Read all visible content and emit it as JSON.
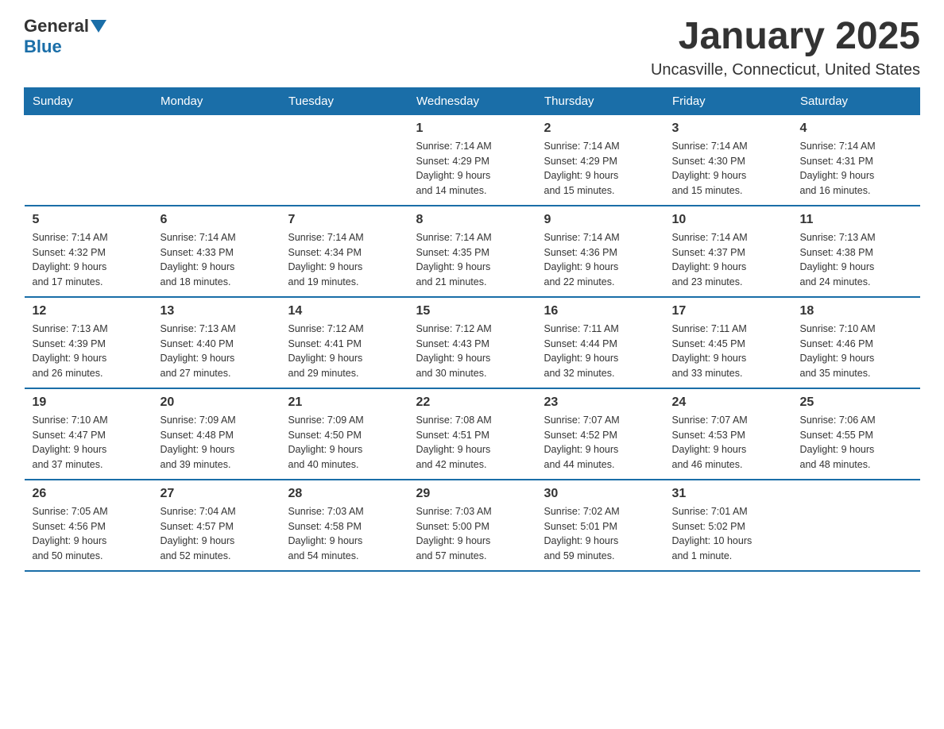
{
  "header": {
    "logo_general": "General",
    "logo_blue": "Blue",
    "month_title": "January 2025",
    "location": "Uncasville, Connecticut, United States"
  },
  "weekdays": [
    "Sunday",
    "Monday",
    "Tuesday",
    "Wednesday",
    "Thursday",
    "Friday",
    "Saturday"
  ],
  "weeks": [
    [
      {
        "day": "",
        "info": ""
      },
      {
        "day": "",
        "info": ""
      },
      {
        "day": "",
        "info": ""
      },
      {
        "day": "1",
        "info": "Sunrise: 7:14 AM\nSunset: 4:29 PM\nDaylight: 9 hours\nand 14 minutes."
      },
      {
        "day": "2",
        "info": "Sunrise: 7:14 AM\nSunset: 4:29 PM\nDaylight: 9 hours\nand 15 minutes."
      },
      {
        "day": "3",
        "info": "Sunrise: 7:14 AM\nSunset: 4:30 PM\nDaylight: 9 hours\nand 15 minutes."
      },
      {
        "day": "4",
        "info": "Sunrise: 7:14 AM\nSunset: 4:31 PM\nDaylight: 9 hours\nand 16 minutes."
      }
    ],
    [
      {
        "day": "5",
        "info": "Sunrise: 7:14 AM\nSunset: 4:32 PM\nDaylight: 9 hours\nand 17 minutes."
      },
      {
        "day": "6",
        "info": "Sunrise: 7:14 AM\nSunset: 4:33 PM\nDaylight: 9 hours\nand 18 minutes."
      },
      {
        "day": "7",
        "info": "Sunrise: 7:14 AM\nSunset: 4:34 PM\nDaylight: 9 hours\nand 19 minutes."
      },
      {
        "day": "8",
        "info": "Sunrise: 7:14 AM\nSunset: 4:35 PM\nDaylight: 9 hours\nand 21 minutes."
      },
      {
        "day": "9",
        "info": "Sunrise: 7:14 AM\nSunset: 4:36 PM\nDaylight: 9 hours\nand 22 minutes."
      },
      {
        "day": "10",
        "info": "Sunrise: 7:14 AM\nSunset: 4:37 PM\nDaylight: 9 hours\nand 23 minutes."
      },
      {
        "day": "11",
        "info": "Sunrise: 7:13 AM\nSunset: 4:38 PM\nDaylight: 9 hours\nand 24 minutes."
      }
    ],
    [
      {
        "day": "12",
        "info": "Sunrise: 7:13 AM\nSunset: 4:39 PM\nDaylight: 9 hours\nand 26 minutes."
      },
      {
        "day": "13",
        "info": "Sunrise: 7:13 AM\nSunset: 4:40 PM\nDaylight: 9 hours\nand 27 minutes."
      },
      {
        "day": "14",
        "info": "Sunrise: 7:12 AM\nSunset: 4:41 PM\nDaylight: 9 hours\nand 29 minutes."
      },
      {
        "day": "15",
        "info": "Sunrise: 7:12 AM\nSunset: 4:43 PM\nDaylight: 9 hours\nand 30 minutes."
      },
      {
        "day": "16",
        "info": "Sunrise: 7:11 AM\nSunset: 4:44 PM\nDaylight: 9 hours\nand 32 minutes."
      },
      {
        "day": "17",
        "info": "Sunrise: 7:11 AM\nSunset: 4:45 PM\nDaylight: 9 hours\nand 33 minutes."
      },
      {
        "day": "18",
        "info": "Sunrise: 7:10 AM\nSunset: 4:46 PM\nDaylight: 9 hours\nand 35 minutes."
      }
    ],
    [
      {
        "day": "19",
        "info": "Sunrise: 7:10 AM\nSunset: 4:47 PM\nDaylight: 9 hours\nand 37 minutes."
      },
      {
        "day": "20",
        "info": "Sunrise: 7:09 AM\nSunset: 4:48 PM\nDaylight: 9 hours\nand 39 minutes."
      },
      {
        "day": "21",
        "info": "Sunrise: 7:09 AM\nSunset: 4:50 PM\nDaylight: 9 hours\nand 40 minutes."
      },
      {
        "day": "22",
        "info": "Sunrise: 7:08 AM\nSunset: 4:51 PM\nDaylight: 9 hours\nand 42 minutes."
      },
      {
        "day": "23",
        "info": "Sunrise: 7:07 AM\nSunset: 4:52 PM\nDaylight: 9 hours\nand 44 minutes."
      },
      {
        "day": "24",
        "info": "Sunrise: 7:07 AM\nSunset: 4:53 PM\nDaylight: 9 hours\nand 46 minutes."
      },
      {
        "day": "25",
        "info": "Sunrise: 7:06 AM\nSunset: 4:55 PM\nDaylight: 9 hours\nand 48 minutes."
      }
    ],
    [
      {
        "day": "26",
        "info": "Sunrise: 7:05 AM\nSunset: 4:56 PM\nDaylight: 9 hours\nand 50 minutes."
      },
      {
        "day": "27",
        "info": "Sunrise: 7:04 AM\nSunset: 4:57 PM\nDaylight: 9 hours\nand 52 minutes."
      },
      {
        "day": "28",
        "info": "Sunrise: 7:03 AM\nSunset: 4:58 PM\nDaylight: 9 hours\nand 54 minutes."
      },
      {
        "day": "29",
        "info": "Sunrise: 7:03 AM\nSunset: 5:00 PM\nDaylight: 9 hours\nand 57 minutes."
      },
      {
        "day": "30",
        "info": "Sunrise: 7:02 AM\nSunset: 5:01 PM\nDaylight: 9 hours\nand 59 minutes."
      },
      {
        "day": "31",
        "info": "Sunrise: 7:01 AM\nSunset: 5:02 PM\nDaylight: 10 hours\nand 1 minute."
      },
      {
        "day": "",
        "info": ""
      }
    ]
  ]
}
